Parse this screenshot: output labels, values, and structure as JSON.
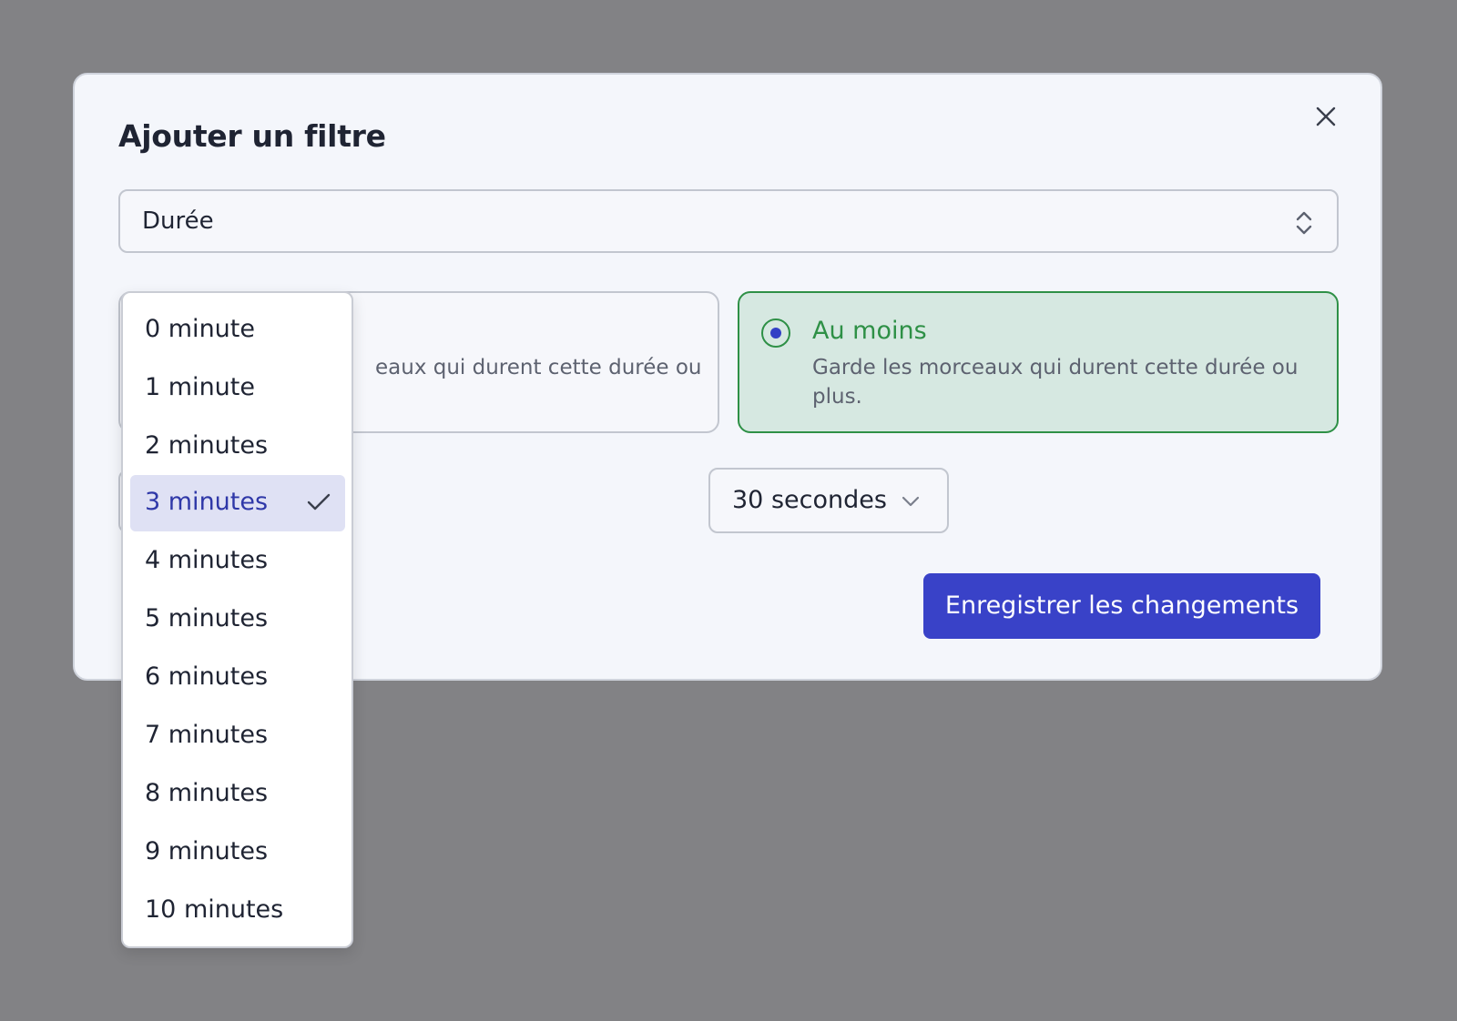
{
  "modal": {
    "title": "Ajouter un filtre",
    "filter_type": "Durée",
    "options": [
      {
        "title": "",
        "description": "eaux qui durent cette durée ou",
        "selected": false
      },
      {
        "title": "Au moins",
        "description": "Garde les morceaux qui durent cette durée ou plus.",
        "selected": true
      }
    ],
    "seconds_value": "30 secondes",
    "save_label": "Enregistrer les changements"
  },
  "minutes_dropdown": {
    "selected": "3 minutes",
    "items": [
      "0 minute",
      "1 minute",
      "2 minutes",
      "3 minutes",
      "4 minutes",
      "5 minutes",
      "6 minutes",
      "7 minutes",
      "8 minutes",
      "9 minutes",
      "10 minutes"
    ]
  },
  "colors": {
    "accent": "#3942c8",
    "success": "#2e9046",
    "success_bg": "#d6e8e1",
    "overlay": "#828285"
  }
}
